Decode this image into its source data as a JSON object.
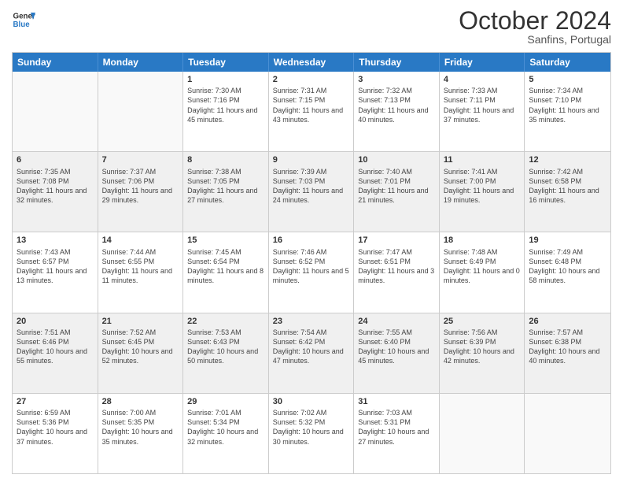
{
  "header": {
    "logo_line1": "General",
    "logo_line2": "Blue",
    "month": "October 2024",
    "location": "Sanfins, Portugal"
  },
  "days_of_week": [
    "Sunday",
    "Monday",
    "Tuesday",
    "Wednesday",
    "Thursday",
    "Friday",
    "Saturday"
  ],
  "rows": [
    [
      {
        "day": "",
        "info": "",
        "empty": true
      },
      {
        "day": "",
        "info": "",
        "empty": true
      },
      {
        "day": "1",
        "info": "Sunrise: 7:30 AM\nSunset: 7:16 PM\nDaylight: 11 hours\nand 45 minutes."
      },
      {
        "day": "2",
        "info": "Sunrise: 7:31 AM\nSunset: 7:15 PM\nDaylight: 11 hours\nand 43 minutes."
      },
      {
        "day": "3",
        "info": "Sunrise: 7:32 AM\nSunset: 7:13 PM\nDaylight: 11 hours\nand 40 minutes."
      },
      {
        "day": "4",
        "info": "Sunrise: 7:33 AM\nSunset: 7:11 PM\nDaylight: 11 hours\nand 37 minutes."
      },
      {
        "day": "5",
        "info": "Sunrise: 7:34 AM\nSunset: 7:10 PM\nDaylight: 11 hours\nand 35 minutes."
      }
    ],
    [
      {
        "day": "6",
        "info": "Sunrise: 7:35 AM\nSunset: 7:08 PM\nDaylight: 11 hours\nand 32 minutes.",
        "shaded": true
      },
      {
        "day": "7",
        "info": "Sunrise: 7:37 AM\nSunset: 7:06 PM\nDaylight: 11 hours\nand 29 minutes.",
        "shaded": true
      },
      {
        "day": "8",
        "info": "Sunrise: 7:38 AM\nSunset: 7:05 PM\nDaylight: 11 hours\nand 27 minutes.",
        "shaded": true
      },
      {
        "day": "9",
        "info": "Sunrise: 7:39 AM\nSunset: 7:03 PM\nDaylight: 11 hours\nand 24 minutes.",
        "shaded": true
      },
      {
        "day": "10",
        "info": "Sunrise: 7:40 AM\nSunset: 7:01 PM\nDaylight: 11 hours\nand 21 minutes.",
        "shaded": true
      },
      {
        "day": "11",
        "info": "Sunrise: 7:41 AM\nSunset: 7:00 PM\nDaylight: 11 hours\nand 19 minutes.",
        "shaded": true
      },
      {
        "day": "12",
        "info": "Sunrise: 7:42 AM\nSunset: 6:58 PM\nDaylight: 11 hours\nand 16 minutes.",
        "shaded": true
      }
    ],
    [
      {
        "day": "13",
        "info": "Sunrise: 7:43 AM\nSunset: 6:57 PM\nDaylight: 11 hours\nand 13 minutes."
      },
      {
        "day": "14",
        "info": "Sunrise: 7:44 AM\nSunset: 6:55 PM\nDaylight: 11 hours\nand 11 minutes."
      },
      {
        "day": "15",
        "info": "Sunrise: 7:45 AM\nSunset: 6:54 PM\nDaylight: 11 hours\nand 8 minutes."
      },
      {
        "day": "16",
        "info": "Sunrise: 7:46 AM\nSunset: 6:52 PM\nDaylight: 11 hours\nand 5 minutes."
      },
      {
        "day": "17",
        "info": "Sunrise: 7:47 AM\nSunset: 6:51 PM\nDaylight: 11 hours\nand 3 minutes."
      },
      {
        "day": "18",
        "info": "Sunrise: 7:48 AM\nSunset: 6:49 PM\nDaylight: 11 hours\nand 0 minutes."
      },
      {
        "day": "19",
        "info": "Sunrise: 7:49 AM\nSunset: 6:48 PM\nDaylight: 10 hours\nand 58 minutes."
      }
    ],
    [
      {
        "day": "20",
        "info": "Sunrise: 7:51 AM\nSunset: 6:46 PM\nDaylight: 10 hours\nand 55 minutes.",
        "shaded": true
      },
      {
        "day": "21",
        "info": "Sunrise: 7:52 AM\nSunset: 6:45 PM\nDaylight: 10 hours\nand 52 minutes.",
        "shaded": true
      },
      {
        "day": "22",
        "info": "Sunrise: 7:53 AM\nSunset: 6:43 PM\nDaylight: 10 hours\nand 50 minutes.",
        "shaded": true
      },
      {
        "day": "23",
        "info": "Sunrise: 7:54 AM\nSunset: 6:42 PM\nDaylight: 10 hours\nand 47 minutes.",
        "shaded": true
      },
      {
        "day": "24",
        "info": "Sunrise: 7:55 AM\nSunset: 6:40 PM\nDaylight: 10 hours\nand 45 minutes.",
        "shaded": true
      },
      {
        "day": "25",
        "info": "Sunrise: 7:56 AM\nSunset: 6:39 PM\nDaylight: 10 hours\nand 42 minutes.",
        "shaded": true
      },
      {
        "day": "26",
        "info": "Sunrise: 7:57 AM\nSunset: 6:38 PM\nDaylight: 10 hours\nand 40 minutes.",
        "shaded": true
      }
    ],
    [
      {
        "day": "27",
        "info": "Sunrise: 6:59 AM\nSunset: 5:36 PM\nDaylight: 10 hours\nand 37 minutes."
      },
      {
        "day": "28",
        "info": "Sunrise: 7:00 AM\nSunset: 5:35 PM\nDaylight: 10 hours\nand 35 minutes."
      },
      {
        "day": "29",
        "info": "Sunrise: 7:01 AM\nSunset: 5:34 PM\nDaylight: 10 hours\nand 32 minutes."
      },
      {
        "day": "30",
        "info": "Sunrise: 7:02 AM\nSunset: 5:32 PM\nDaylight: 10 hours\nand 30 minutes."
      },
      {
        "day": "31",
        "info": "Sunrise: 7:03 AM\nSunset: 5:31 PM\nDaylight: 10 hours\nand 27 minutes."
      },
      {
        "day": "",
        "info": "",
        "empty": true
      },
      {
        "day": "",
        "info": "",
        "empty": true
      }
    ]
  ]
}
